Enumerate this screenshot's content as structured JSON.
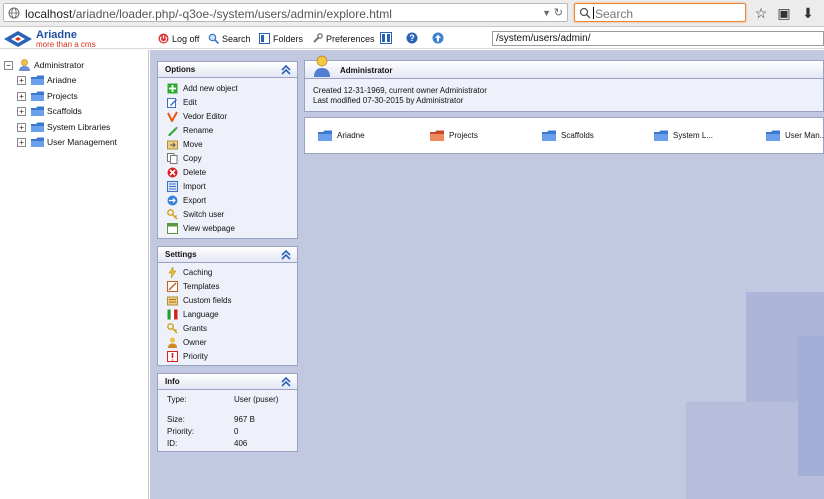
{
  "browser": {
    "url_host": "localhost",
    "url_path": "/ariadne/loader.php/-q3oe-/system/users/admin/explore.html",
    "search_placeholder": "Search"
  },
  "app": {
    "logo_name": "Ariadne",
    "logo_tagline": "more than a cms",
    "toolbar": {
      "logoff": "Log off",
      "search": "Search",
      "folders": "Folders",
      "preferences": "Preferences"
    },
    "path": "/system/users/admin/"
  },
  "tree": {
    "root": "Administrator",
    "items": [
      {
        "label": "Ariadne"
      },
      {
        "label": "Projects"
      },
      {
        "label": "Scaffolds"
      },
      {
        "label": "System Libraries"
      },
      {
        "label": "User Management"
      }
    ]
  },
  "options": {
    "title": "Options",
    "items": [
      {
        "label": "Add new object",
        "icon": "add-icon"
      },
      {
        "label": "Edit",
        "icon": "edit-icon"
      },
      {
        "label": "Vedor Editor",
        "icon": "vedor-icon"
      },
      {
        "label": "Rename",
        "icon": "rename-icon"
      },
      {
        "label": "Move",
        "icon": "move-icon"
      },
      {
        "label": "Copy",
        "icon": "copy-icon"
      },
      {
        "label": "Delete",
        "icon": "delete-icon"
      },
      {
        "label": "Import",
        "icon": "import-icon"
      },
      {
        "label": "Export",
        "icon": "export-icon"
      },
      {
        "label": "Switch user",
        "icon": "key-icon"
      },
      {
        "label": "View webpage",
        "icon": "webpage-icon"
      }
    ]
  },
  "settings": {
    "title": "Settings",
    "items": [
      {
        "label": "Caching",
        "icon": "caching-icon"
      },
      {
        "label": "Templates",
        "icon": "templates-icon"
      },
      {
        "label": "Custom fields",
        "icon": "custom-fields-icon"
      },
      {
        "label": "Language",
        "icon": "language-icon"
      },
      {
        "label": "Grants",
        "icon": "grants-icon"
      },
      {
        "label": "Owner",
        "icon": "owner-icon"
      },
      {
        "label": "Priority",
        "icon": "priority-icon"
      }
    ]
  },
  "info": {
    "title": "Info",
    "rows": [
      {
        "key": "Type:",
        "value": "User (puser)"
      },
      {
        "key": "Size:",
        "value": "967 B"
      },
      {
        "key": "Priority:",
        "value": "0"
      },
      {
        "key": "ID:",
        "value": "406"
      }
    ]
  },
  "object": {
    "title": "Administrator",
    "created": "Created 12-31-1969, current owner Administrator",
    "modified": "Last modified 07-30-2015 by Administrator"
  },
  "children": [
    {
      "label": "Ariadne"
    },
    {
      "label": "Projects"
    },
    {
      "label": "Scaffolds"
    },
    {
      "label": "System L..."
    },
    {
      "label": "User Man..."
    }
  ]
}
